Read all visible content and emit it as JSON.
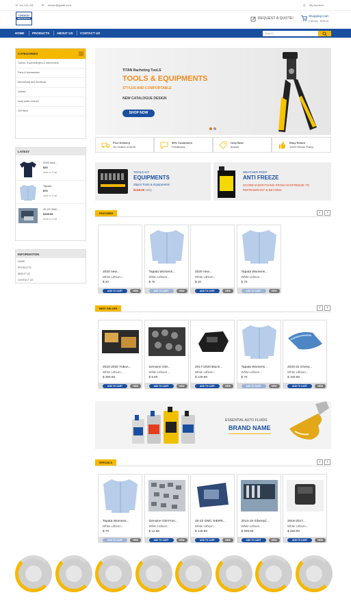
{
  "topbar": {
    "phone": "111-111-111",
    "email": "choice@gmail.com",
    "account": "My Account"
  },
  "header": {
    "logo_line1": "CHOICE",
    "logo_line2": "WHOLESALE",
    "request_quote": "REQUEST A QUOTE!",
    "cart_label": "Shopping Cart",
    "cart_sub": "0 item(s) - $499.99"
  },
  "nav": {
    "items": [
      "HOME",
      "PRODUCTS",
      "ABOUT US",
      "CONTACT US"
    ],
    "search_placeholder": "Search"
  },
  "sidebar": {
    "categories_title": "CATEGORIES",
    "categories": [
      "Turbos, Superchargers & Intercoolers",
      "Parts & Accessories",
      "Mechanical and Workload",
      "clothes",
      "body parts/ exterior",
      "Oil Filters"
    ],
    "latest_title": "LATEST",
    "latest": [
      {
        "name": "2020 new...",
        "price": "$20",
        "action": "Add to Cart"
      },
      {
        "name": "Tapata...",
        "price": "$70",
        "action": "Add to Cart"
      },
      {
        "name": "20-22 GMC...",
        "price": "$165.99",
        "action": "Add to Cart"
      }
    ],
    "info_title": "INFORMATION",
    "info_items": [
      "HOME",
      "PRODUCTS",
      "ABOUT US",
      "CONTACT US"
    ]
  },
  "banner": {
    "kicker": "TITAN Racheting TooLS",
    "title": "TOOLS & EQUIPMENTS",
    "subtitle": "STYLUS AND COMFORTABLE",
    "tagline": "NEW CATALOGUE DESIGN",
    "cta": "SHOP NOW"
  },
  "features": [
    {
      "title": "Free Delivery",
      "sub": "On Orders of $100"
    },
    {
      "title": "99% Customers",
      "sub": "Feedbacks"
    },
    {
      "title": "Only Best",
      "sub": "brands"
    },
    {
      "title": "Easy Return",
      "sub": "100% Return Policy"
    }
  ],
  "promo1": {
    "kicker": "TOOLS KIT",
    "title": "EQUIPMENTS",
    "sub": "25pcs Tools & Equipments",
    "price": "$149.00",
    "price_suffix": "Only"
  },
  "promo2": {
    "kicker": "WEATHER PREP",
    "title": "ANTI FREEZE",
    "sub": "SCORE EVERYTHING FROM ANTIFREEZE TO REFRIGERANT & BEYOND"
  },
  "sections": {
    "featured": "FEATURED",
    "bestseller": "BEST SELLER",
    "specials": "SPECIALS"
  },
  "buttons": {
    "add": "ADD TO CART",
    "view": "VIEW"
  },
  "featured_products": [
    {
      "name": "2020 new...",
      "brand": "White Lithium...",
      "price": "$ 20"
    },
    {
      "name": "Tapata Womens...",
      "brand": "White Lithium...",
      "price": "$ 70"
    },
    {
      "name": "2020 new...",
      "brand": "White Lithium...",
      "price": "$ 20"
    },
    {
      "name": "Tapata Womens...",
      "brand": "White Lithium...",
      "price": "$ 70"
    }
  ],
  "bestseller_products": [
    {
      "name": "2015-2020 Yukon...",
      "brand": "White Lithium...",
      "price": "$ 399.99"
    },
    {
      "name": "Genuine GM...",
      "brand": "White Lithium...",
      "price": "$ 9.99"
    },
    {
      "name": "2017-2020 Buick...",
      "brand": "White Lithium...",
      "price": "$ 129.99"
    },
    {
      "name": "Tapata Womens...",
      "brand": "White Lithium...",
      "price": "$ 70"
    },
    {
      "name": "2020-22 Chevy...",
      "brand": "White Lithium...",
      "price": "$ 169.99"
    }
  ],
  "brand_banner": {
    "kicker": "ESSENTIAL AUTO FLUIDS",
    "title": "BRAND NAME"
  },
  "specials_products": [
    {
      "name": "Tapata Womens...",
      "brand": "White Lithium...",
      "price": "$ 70"
    },
    {
      "name": "Genuine GM Fron...",
      "brand": "White Lithium...",
      "price": "$ 12.99"
    },
    {
      "name": "20-22 GMC SIERR...",
      "brand": "White Lithium...",
      "price": "$ 149.99"
    },
    {
      "name": "2014-18 Silverad...",
      "brand": "White Lithium...",
      "price": "$ 899.99"
    },
    {
      "name": "2016-2017...",
      "brand": "White Lithium...",
      "price": "$ 299.99"
    }
  ],
  "colors": {
    "brand_blue": "#1a4fa0",
    "accent_yellow": "#f5b800",
    "promo_red": "#e53d1c",
    "banner_orange": "#f08a1c"
  }
}
